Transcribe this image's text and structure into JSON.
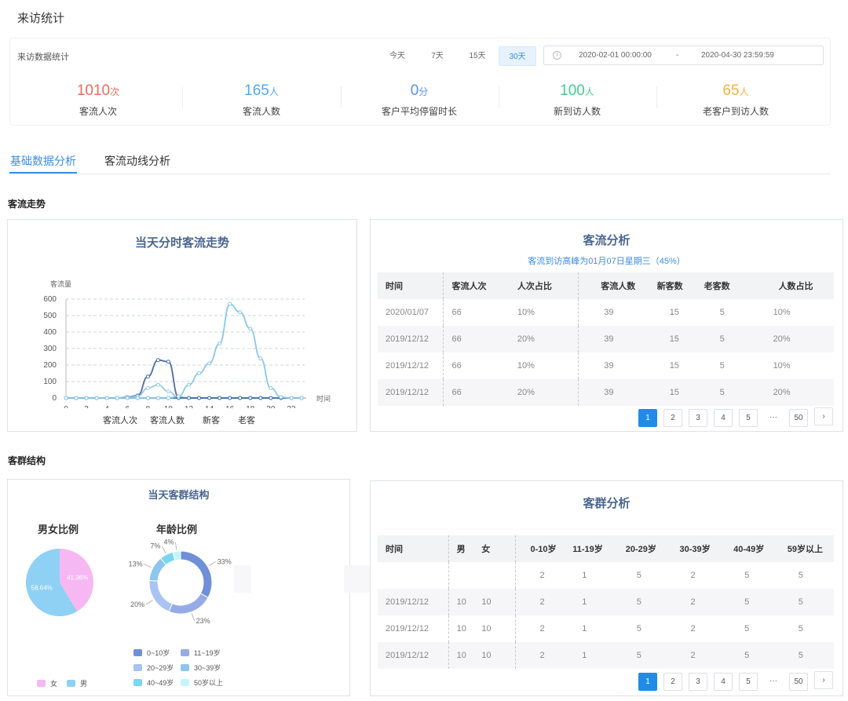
{
  "page": {
    "title": "来访统计"
  },
  "stats_header": {
    "title": "来访数据统计",
    "ranges": [
      "今天",
      "7天",
      "15天",
      "30天"
    ],
    "active_range": "30天",
    "date_start": "2020-02-01 00:00:00",
    "date_sep": "-",
    "date_end": "2020-04-30 23:59:59"
  },
  "stats": [
    {
      "value": "1010",
      "unit": "次",
      "label": "客流人次",
      "color": "#ef6a5c"
    },
    {
      "value": "165",
      "unit": "人",
      "label": "客流人数",
      "color": "#4fa8f0"
    },
    {
      "value": "0",
      "unit": "分",
      "label": "客户平均停留时长",
      "color": "#5c8ef0"
    },
    {
      "value": "100",
      "unit": "人",
      "label": "新到访人数",
      "color": "#3fcf8e"
    },
    {
      "value": "65",
      "unit": "人",
      "label": "老客户到访人数",
      "color": "#f2b33d"
    }
  ],
  "tabs": [
    "基础数据分析",
    "客流动线分析"
  ],
  "section1": {
    "title": "客流走势"
  },
  "section2": {
    "title": "客群结构"
  },
  "trend_chart": {
    "title": "当天分时客流走势",
    "ylabel": "客流量",
    "xlabel": "时间",
    "legend": [
      "客流人次",
      "客流人数",
      "新客",
      "老客"
    ]
  },
  "chart_data": [
    {
      "type": "line",
      "title": "当天分时客流走势",
      "xlabel": "时间",
      "ylabel": "客流量",
      "x": [
        0,
        1,
        2,
        3,
        4,
        5,
        6,
        7,
        8,
        9,
        10,
        11,
        12,
        13,
        14,
        15,
        16,
        17,
        18,
        19,
        20,
        21,
        22,
        23
      ],
      "xticks": [
        "0",
        "2",
        "4",
        "6",
        "8",
        "10",
        "12",
        "14",
        "16",
        "18",
        "20",
        "22"
      ],
      "yticks": [
        "0",
        "100",
        "200",
        "300",
        "400",
        "500",
        "600"
      ],
      "ylim": [
        0,
        600
      ],
      "grid": true,
      "series": [
        {
          "name": "客流人次",
          "color": "#4b6da8",
          "values": [
            0,
            0,
            0,
            0,
            0,
            0,
            5,
            15,
            130,
            230,
            220,
            5,
            0,
            0,
            0,
            0,
            0,
            0,
            0,
            0,
            0,
            0,
            0,
            0
          ]
        },
        {
          "name": "客流人数",
          "color": "#9ccbe9",
          "values": [
            0,
            0,
            0,
            0,
            0,
            0,
            3,
            10,
            60,
            80,
            40,
            3,
            0,
            0,
            0,
            0,
            0,
            0,
            0,
            0,
            0,
            0,
            0,
            0
          ]
        },
        {
          "name": "新客",
          "color": "#3e6aa3",
          "values": [
            0,
            0,
            0,
            0,
            0,
            0,
            0,
            0,
            0,
            0,
            0,
            0,
            0,
            0,
            0,
            0,
            0,
            0,
            0,
            0,
            0,
            0,
            0,
            0
          ]
        },
        {
          "name": "老客",
          "color": "#8ac8ec",
          "values": [
            0,
            0,
            0,
            0,
            0,
            0,
            0,
            0,
            0,
            0,
            0,
            10,
            80,
            150,
            210,
            330,
            570,
            520,
            420,
            240,
            60,
            5,
            0,
            0
          ]
        }
      ]
    },
    {
      "type": "pie",
      "title": "男女比例",
      "slices": [
        {
          "name": "女",
          "value": 41.36,
          "label": "41.36%",
          "color": "#f7b7f3"
        },
        {
          "name": "男",
          "value": 58.64,
          "label": "58.64%",
          "color": "#8fd0f5"
        }
      ]
    },
    {
      "type": "pie",
      "title": "年龄比例",
      "slices": [
        {
          "name": "0~10岁",
          "value": 33,
          "label": "33%",
          "color": "#6f8fd8"
        },
        {
          "name": "11~19岁",
          "value": 23,
          "label": "23%",
          "color": "#96abe6"
        },
        {
          "name": "20~29岁",
          "value": 20,
          "label": "20%",
          "color": "#a9c4f2"
        },
        {
          "name": "30~39岁",
          "value": 13,
          "label": "13%",
          "color": "#8cc6ee"
        },
        {
          "name": "40~49岁",
          "value": 7,
          "label": "7%",
          "color": "#7cd6f2"
        },
        {
          "name": "50岁以上",
          "value": 4,
          "label": "4%",
          "color": "#c4f4fa"
        }
      ]
    }
  ],
  "flow_table": {
    "title": "客流分析",
    "subtitle": "客流到访高峰为01月07日星期三（45%）",
    "columns": [
      "时间",
      "客流人次",
      "人次占比",
      "客流人数",
      "新客数",
      "老客数",
      "人数占比"
    ],
    "rows": [
      [
        "2020/01/07",
        "66",
        "10%",
        "39",
        "15",
        "5",
        "10%"
      ],
      [
        "2019/12/12",
        "66",
        "20%",
        "39",
        "15",
        "5",
        "20%"
      ],
      [
        "2019/12/12",
        "66",
        "10%",
        "39",
        "15",
        "5",
        "10%"
      ],
      [
        "2019/12/12",
        "66",
        "20%",
        "39",
        "15",
        "5",
        "20%"
      ]
    ]
  },
  "group_chart": {
    "title": "当天客群结构",
    "gender_title": "男女比例",
    "age_title": "年龄比例",
    "gender_legend": [
      "女",
      "男"
    ],
    "age_legend": [
      "0~10岁",
      "11~19岁",
      "20~29岁",
      "30~39岁",
      "40~49岁",
      "50岁以上"
    ],
    "age_labels": [
      "33%",
      "23%",
      "20%",
      "13%",
      "7%",
      "4%"
    ]
  },
  "group_table": {
    "title": "客群分析",
    "columns": [
      "时间",
      "男",
      "女",
      "0-10岁",
      "11-19岁",
      "20-29岁",
      "30-39岁",
      "40-49岁",
      "59岁以上"
    ],
    "rows": [
      [
        "",
        "",
        "",
        "2",
        "1",
        "5",
        "2",
        "5",
        "5"
      ],
      [
        "2019/12/12",
        "10",
        "10",
        "2",
        "1",
        "5",
        "2",
        "5",
        "5"
      ],
      [
        "2019/12/12",
        "10",
        "10",
        "2",
        "1",
        "5",
        "2",
        "5",
        "5"
      ],
      [
        "2019/12/12",
        "10",
        "10",
        "2",
        "1",
        "5",
        "2",
        "5",
        "5"
      ]
    ]
  },
  "pager": {
    "pages": [
      "1",
      "2",
      "3",
      "4",
      "5",
      "···",
      "50"
    ],
    "next": "›",
    "active": "1"
  }
}
